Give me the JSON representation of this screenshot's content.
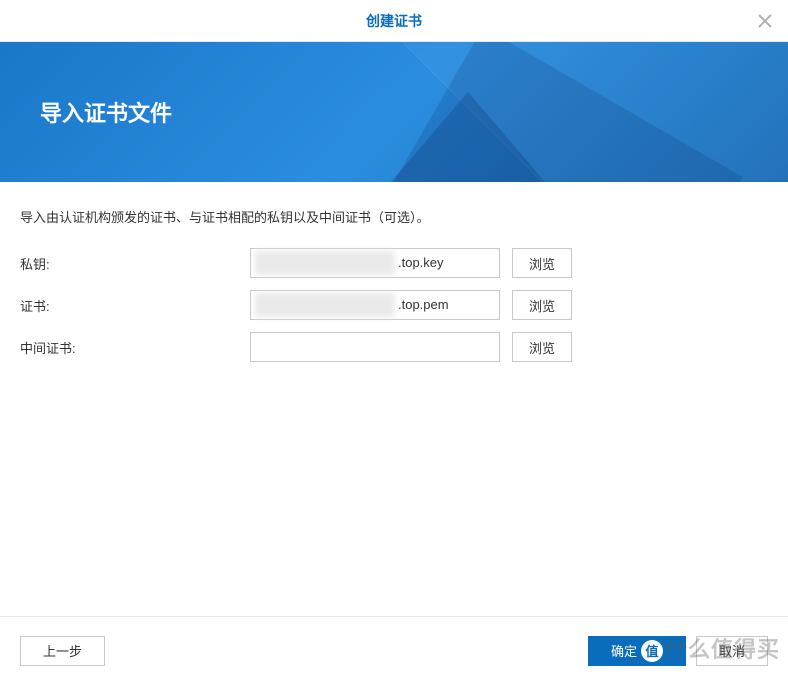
{
  "header": {
    "title": "创建证书"
  },
  "banner": {
    "title": "导入证书文件"
  },
  "content": {
    "description": "导入由认证机构颁发的证书、与证书相配的私钥以及中间证书（可选）。"
  },
  "form": {
    "private_key": {
      "label": "私钥:",
      "value_suffix": ".top.key",
      "browse": "浏览"
    },
    "certificate": {
      "label": "证书:",
      "value_suffix": ".top.pem",
      "browse": "浏览"
    },
    "intermediate": {
      "label": "中间证书:",
      "value": "",
      "browse": "浏览"
    }
  },
  "footer": {
    "back": "上一步",
    "ok": "确定",
    "ok_icon": "值",
    "cancel": "取消"
  },
  "watermark": "什么值得买"
}
